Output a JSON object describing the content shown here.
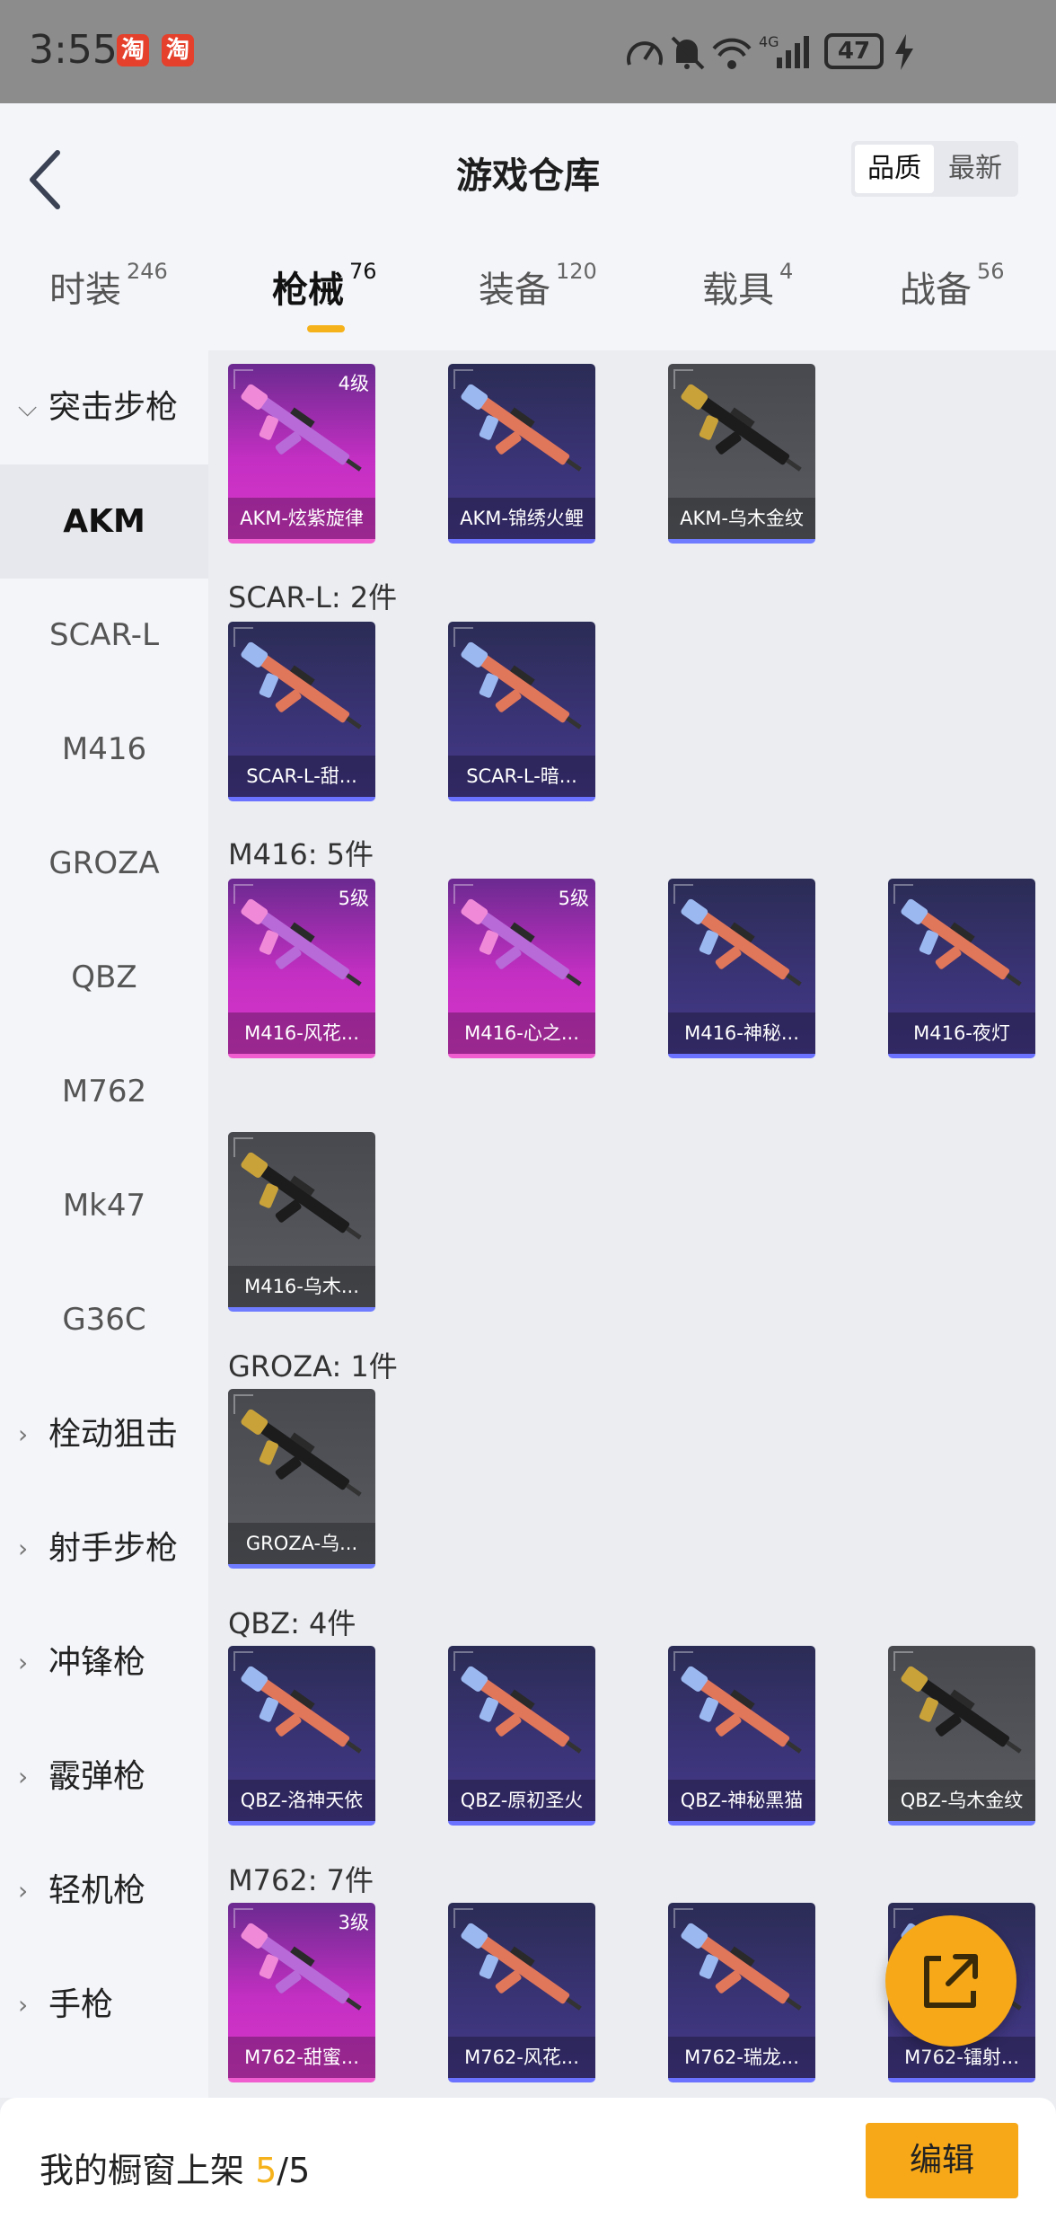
{
  "status_bar": {
    "time": "3:55",
    "taobao_badge": "淘",
    "signal": "4G",
    "battery": "47"
  },
  "header": {
    "title": "游戏仓库",
    "sort_options": [
      "品质",
      "最新"
    ]
  },
  "tabs": [
    {
      "label": "时装",
      "count": "246"
    },
    {
      "label": "枪械",
      "count": "76"
    },
    {
      "label": "装备",
      "count": "120"
    },
    {
      "label": "载具",
      "count": "4"
    },
    {
      "label": "战备",
      "count": "56"
    }
  ],
  "sidebar": {
    "expanded_category": "突击步枪",
    "sub_items": [
      "AKM",
      "SCAR-L",
      "M416",
      "GROZA",
      "QBZ",
      "M762",
      "Mk47",
      "G36C"
    ],
    "categories": [
      "栓动狙击",
      "射手步枪",
      "冲锋枪",
      "霰弹枪",
      "轻机枪",
      "手枪"
    ]
  },
  "sections": [
    {
      "title": "",
      "items": [
        {
          "name": "AKM-炫紫旋律",
          "level": "4级",
          "quality": "pink"
        },
        {
          "name": "AKM-锦绣火鲤",
          "level": "",
          "quality": "purple"
        },
        {
          "name": "AKM-乌木金纹",
          "level": "",
          "quality": "gray"
        }
      ]
    },
    {
      "title": "SCAR-L: 2件",
      "items": [
        {
          "name": "SCAR-L-甜...",
          "level": "",
          "quality": "purple"
        },
        {
          "name": "SCAR-L-暗...",
          "level": "",
          "quality": "purple"
        }
      ]
    },
    {
      "title": "M416: 5件",
      "items": [
        {
          "name": "M416-风花...",
          "level": "5级",
          "quality": "pink"
        },
        {
          "name": "M416-心之...",
          "level": "5级",
          "quality": "pink"
        },
        {
          "name": "M416-神秘...",
          "level": "",
          "quality": "purple"
        },
        {
          "name": "M416-夜灯",
          "level": "",
          "quality": "purple"
        },
        {
          "name": "M416-乌木...",
          "level": "",
          "quality": "gray"
        }
      ]
    },
    {
      "title": "GROZA: 1件",
      "items": [
        {
          "name": "GROZA-乌...",
          "level": "",
          "quality": "gray"
        }
      ]
    },
    {
      "title": "QBZ: 4件",
      "items": [
        {
          "name": "QBZ-洛神天依",
          "level": "",
          "quality": "purple"
        },
        {
          "name": "QBZ-原初圣火",
          "level": "",
          "quality": "purple"
        },
        {
          "name": "QBZ-神秘黑猫",
          "level": "",
          "quality": "purple"
        },
        {
          "name": "QBZ-乌木金纹",
          "level": "",
          "quality": "gray"
        }
      ]
    },
    {
      "title": "M762: 7件",
      "items": [
        {
          "name": "M762-甜蜜...",
          "level": "3级",
          "quality": "pink"
        },
        {
          "name": "M762-风花...",
          "level": "",
          "quality": "purple"
        },
        {
          "name": "M762-瑞龙...",
          "level": "",
          "quality": "purple"
        },
        {
          "name": "M762-镭射...",
          "level": "",
          "quality": "purple"
        }
      ]
    }
  ],
  "bottom_bar": {
    "prefix": "我的橱窗上架 ",
    "current": "5",
    "total": "/5",
    "edit_label": "编辑"
  },
  "colors": {
    "accent": "#f6a818",
    "epic_pink": "#d737c8",
    "rare_purple": "#45398a",
    "common_gray": "#5a5c62"
  }
}
